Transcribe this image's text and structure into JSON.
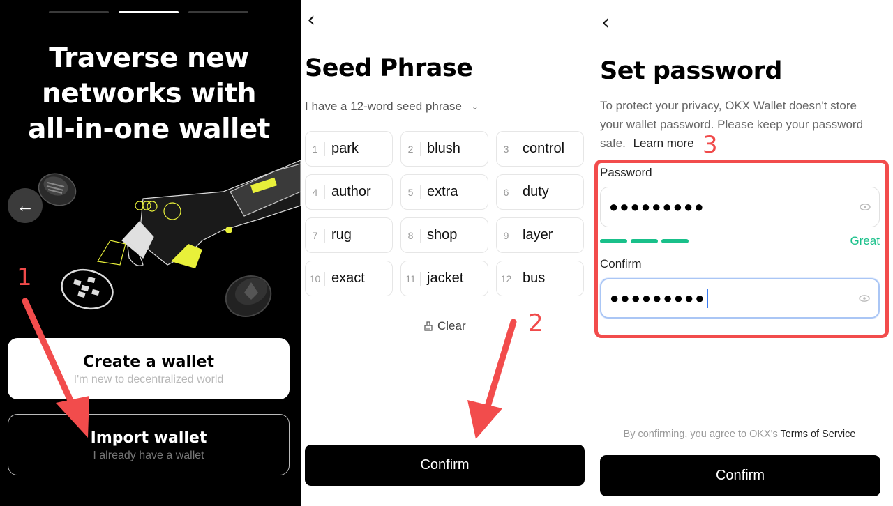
{
  "screens": {
    "onboarding": {
      "pager_count": 3,
      "pager_active_index": 1,
      "title_lines": [
        "Traverse new",
        "networks with",
        "all-in-one wallet"
      ],
      "back_icon": "arrow-left-icon",
      "create_wallet": {
        "label": "Create a wallet",
        "sublabel": "I'm new to decentralized world"
      },
      "import_wallet": {
        "label": "Import wallet",
        "sublabel": "I already have a wallet"
      }
    },
    "seed_phrase": {
      "back_icon": "chevron-left-icon",
      "title": "Seed Phrase",
      "word_count_selector": "I have a 12-word seed phrase",
      "words": [
        {
          "index": "1",
          "word": "park"
        },
        {
          "index": "2",
          "word": "blush"
        },
        {
          "index": "3",
          "word": "control"
        },
        {
          "index": "4",
          "word": "author"
        },
        {
          "index": "5",
          "word": "extra"
        },
        {
          "index": "6",
          "word": "duty"
        },
        {
          "index": "7",
          "word": "rug"
        },
        {
          "index": "8",
          "word": "shop"
        },
        {
          "index": "9",
          "word": "layer"
        },
        {
          "index": "10",
          "word": "exact"
        },
        {
          "index": "11",
          "word": "jacket"
        },
        {
          "index": "12",
          "word": "bus"
        }
      ],
      "clear_label": "Clear",
      "confirm_label": "Confirm"
    },
    "set_password": {
      "back_icon": "chevron-left-icon",
      "title": "Set password",
      "description": "To protect your privacy, OKX Wallet doesn't store your wallet password. Please keep your password safe.",
      "learn_more": "Learn more",
      "password_label": "Password",
      "password_value": "●●●●●●●●●",
      "strength_bars_filled": 3,
      "strength_label": "Great",
      "confirm_label_field": "Confirm",
      "confirm_value": "●●●●●●●●●",
      "tos_prefix": "By confirming, you agree to OKX's ",
      "tos_link": "Terms of Service",
      "confirm_button": "Confirm"
    }
  },
  "annotations": {
    "step1": "1",
    "step2": "2",
    "step3": "3"
  },
  "colors": {
    "annotation_red": "#f24c4c",
    "strength_green": "#19c08a",
    "focus_blue": "#3b7bf0",
    "neon_yellow": "#e8f03a"
  }
}
